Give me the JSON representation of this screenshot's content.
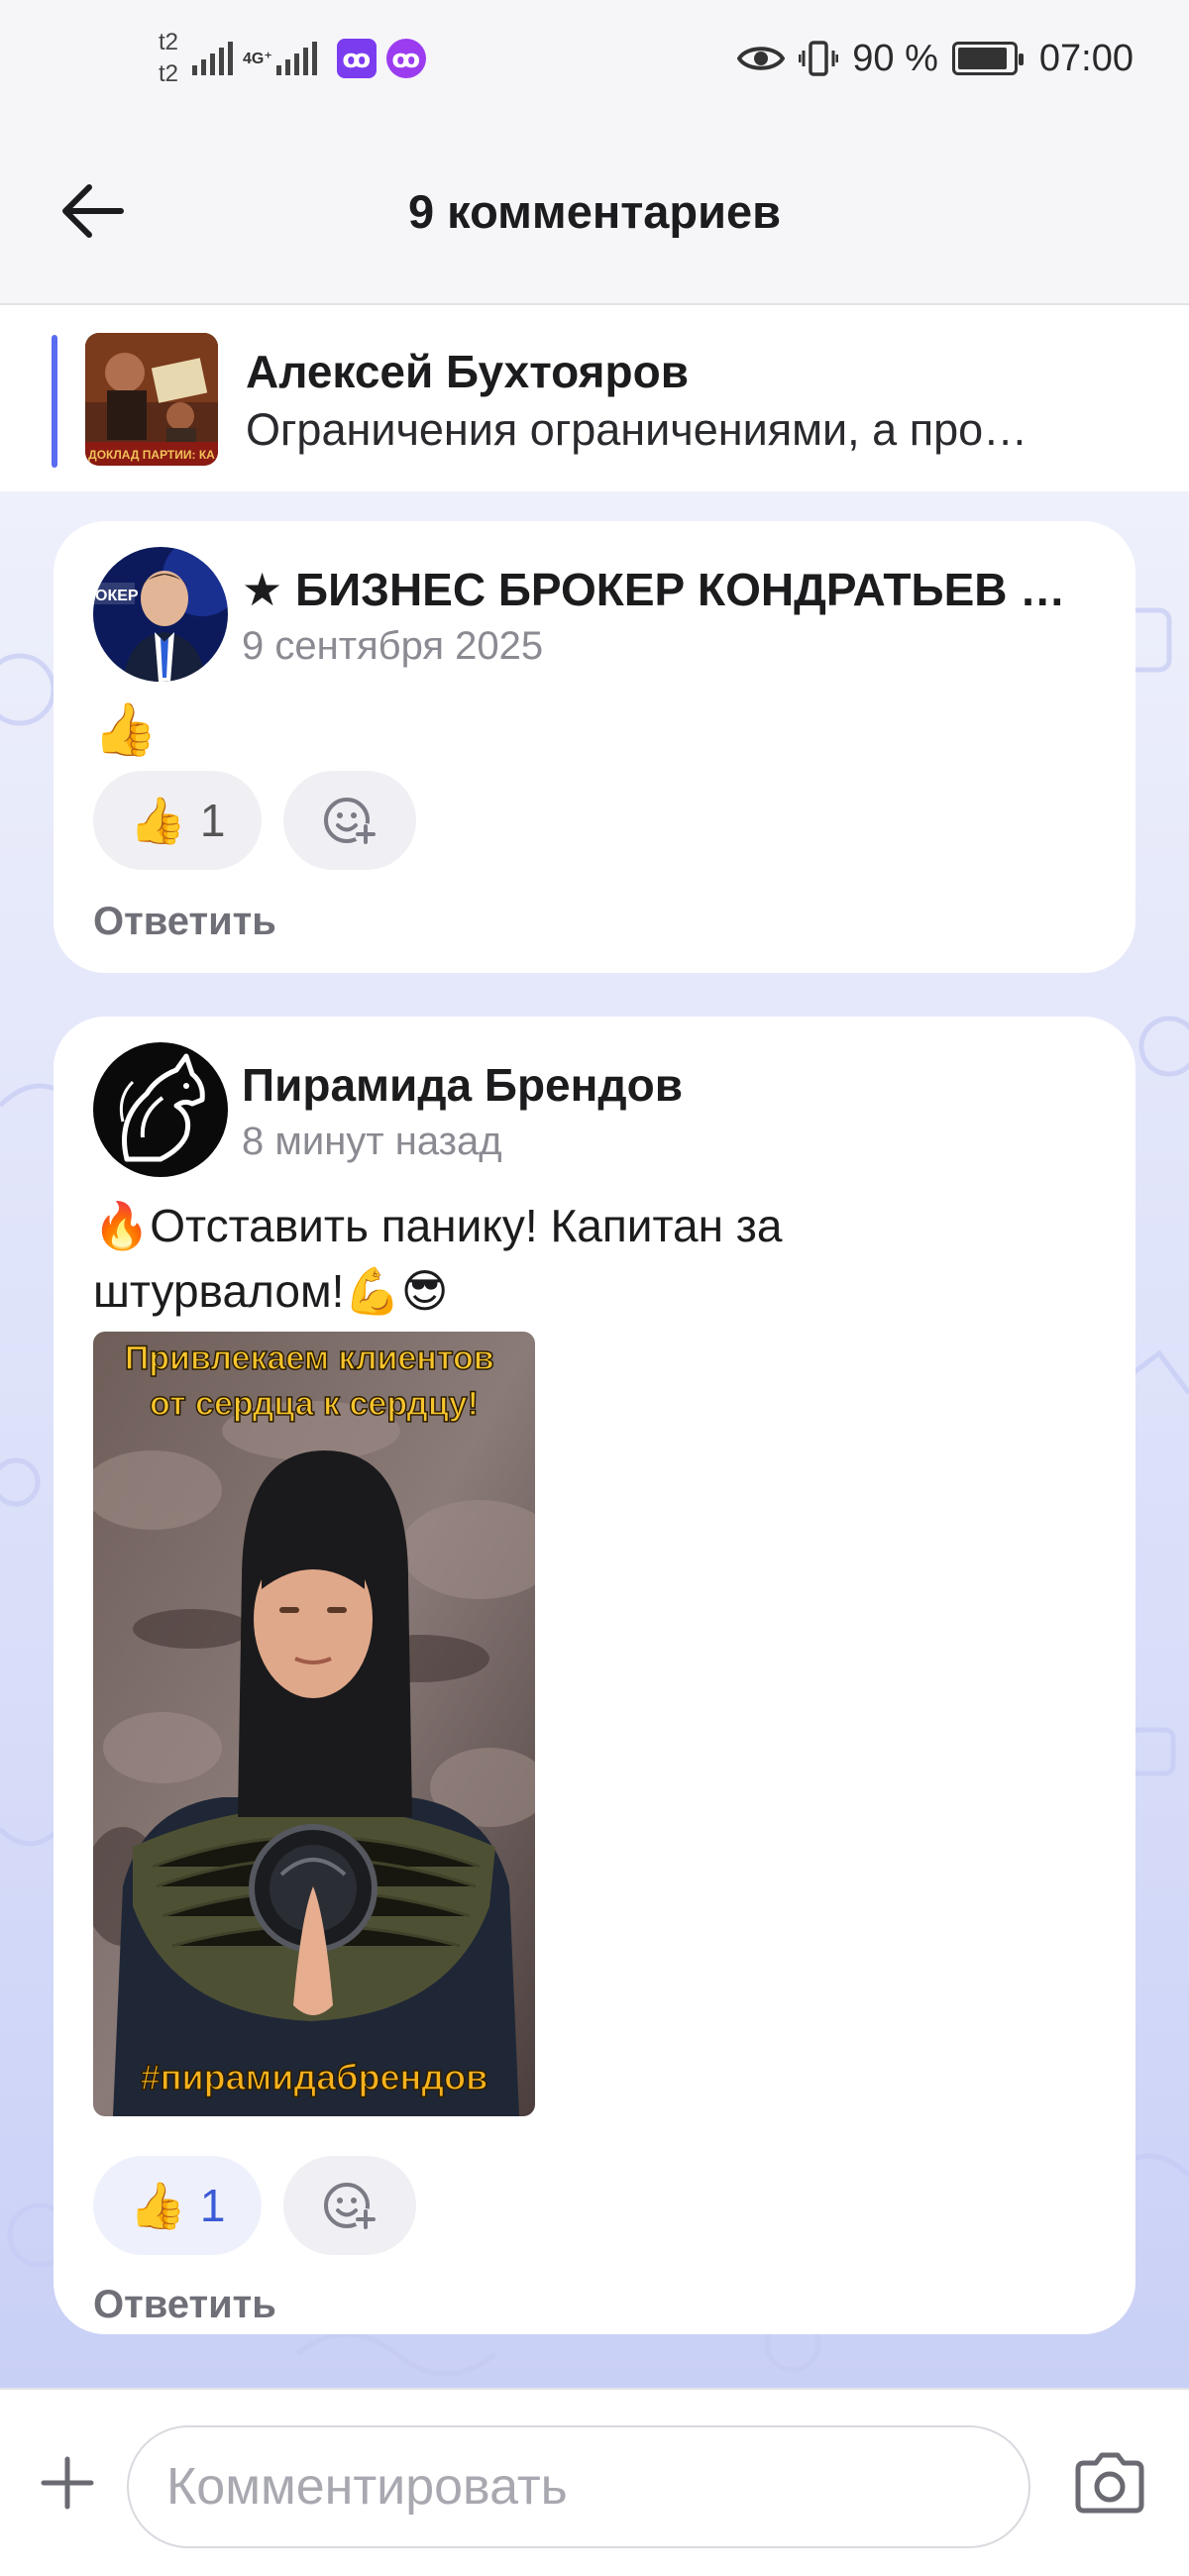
{
  "status_bar": {
    "carrier_1": "t2",
    "carrier_2": "t2",
    "network": "4G⁺",
    "app_icon_1": "ꝏ",
    "app_icon_2": "ꝏ",
    "battery_percent": "90 %",
    "battery_level": 0.9,
    "time": "07:00",
    "icons": [
      "signal-icon",
      "eye-icon",
      "vibrate-icon",
      "battery-icon"
    ]
  },
  "header": {
    "title": "9 комментариев",
    "back_icon": "arrow-left-icon"
  },
  "pinned_post": {
    "author": "Алексей Бухтояров",
    "text": "Ограничения ограничениями, а про…",
    "thumbnail_caption": "ДОКЛАД ПАРТИИ: КА"
  },
  "comments": [
    {
      "author": "★ БИЗНЕС БРОКЕР КОНДРАТЬЕВ …",
      "avatar_caption": "ОКЕР",
      "date": "9 сентября 2025",
      "body_emoji": "👍",
      "reaction_emoji": "👍",
      "reaction_count": "1",
      "reaction_active": false,
      "add_reaction_icon": "add-emoji-icon",
      "reply_label": "Ответить"
    },
    {
      "author": "Пирамида Брендов",
      "date": "8 минут назад",
      "text_line_1": "🔥Отставить панику! Капитан за",
      "text_line_2": "штурвалом!💪😎",
      "image_caption_top": "Привлекаем клиентов от сердца к сердцу!",
      "image_caption_bottom": "#пирамидабрендов",
      "reaction_emoji": "👍",
      "reaction_count": "1",
      "reaction_active": true,
      "add_reaction_icon": "add-emoji-icon",
      "reply_label": "Ответить"
    }
  ],
  "input_bar": {
    "placeholder": "Комментировать",
    "value": "",
    "attach_icon": "plus-icon",
    "camera_icon": "camera-icon"
  },
  "colors": {
    "accent": "#5a6cf0",
    "reaction_active_text": "#3b5bd6",
    "background_top": "#eef0fb",
    "background_bottom": "#c9d0f6"
  }
}
